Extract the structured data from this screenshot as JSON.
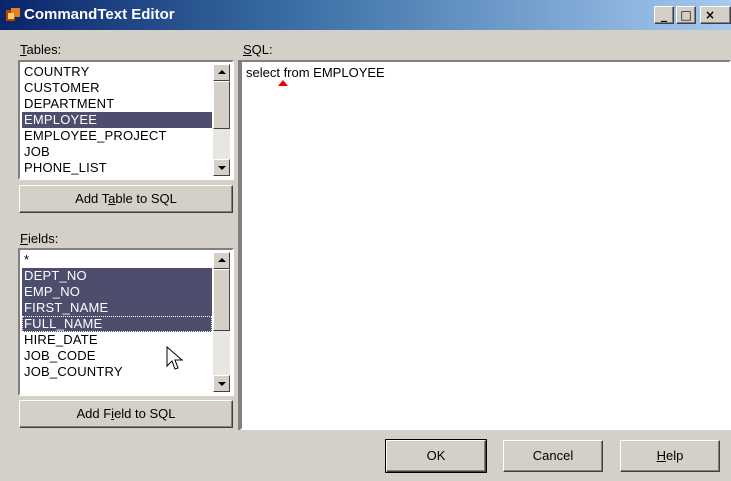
{
  "window": {
    "title": "CommandText Editor",
    "controls": {
      "minimize": "_",
      "maximize": "□",
      "close": "×"
    }
  },
  "tables": {
    "label_prefix": "",
    "label_accel": "T",
    "label_rest": "ables:",
    "items": [
      "COUNTRY",
      "CUSTOMER",
      "DEPARTMENT",
      "EMPLOYEE",
      "EMPLOYEE_PROJECT",
      "JOB",
      "PHONE_LIST"
    ],
    "selected_index": 3,
    "add_button": {
      "prefix": "Add T",
      "accel": "a",
      "rest": "ble to SQL"
    }
  },
  "fields": {
    "label_accel": "F",
    "label_rest": "ields:",
    "items": [
      "*",
      "DEPT_NO",
      "EMP_NO",
      "FIRST_NAME",
      "FULL_NAME",
      "HIRE_DATE",
      "JOB_CODE",
      "JOB_COUNTRY"
    ],
    "selected_indices": [
      1,
      2,
      3,
      4
    ],
    "focused_index": 4,
    "add_button": {
      "prefix": "Add F",
      "accel": "i",
      "rest": "eld to SQL"
    }
  },
  "sql": {
    "label_accel": "S",
    "label_rest": "QL:",
    "text": "select  from EMPLOYEE"
  },
  "footer": {
    "ok": "OK",
    "cancel": "Cancel",
    "help_accel": "H",
    "help_rest": "elp"
  },
  "colors": {
    "selection": "#4d4d6e",
    "titlebar": "#0a246a",
    "caret_marker": "#e00000"
  }
}
